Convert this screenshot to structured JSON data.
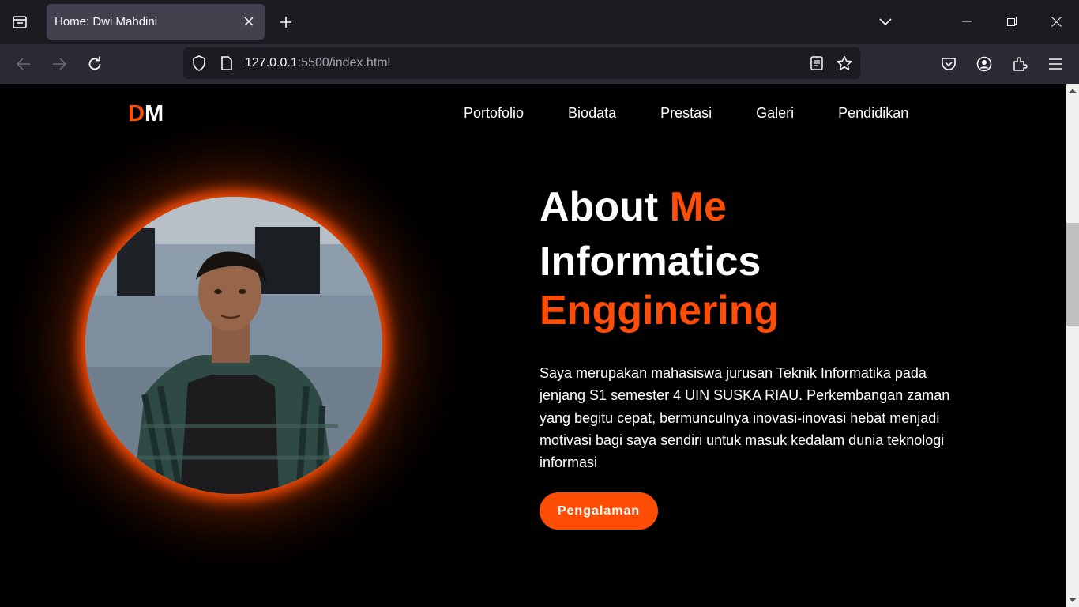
{
  "browser": {
    "tab": {
      "title": "Home: Dwi Mahdini"
    },
    "url": {
      "host": "127.0.0.1",
      "rest": ":5500/index.html"
    },
    "icons": [
      "tab-list-icon",
      "close-icon",
      "plus-icon",
      "chevron-down-icon",
      "minimize-icon",
      "restore-icon",
      "window-close-icon",
      "back-arrow-icon",
      "forward-arrow-icon",
      "reload-icon",
      "shield-icon",
      "page-icon",
      "reader-view-icon",
      "star-icon",
      "pocket-icon",
      "account-icon",
      "extensions-icon",
      "menu-icon"
    ]
  },
  "page": {
    "logo": {
      "first": "D",
      "second": "M"
    },
    "nav": [
      "Portofolio",
      "Biodata",
      "Prestasi",
      "Galeri",
      "Pendidikan"
    ],
    "hero": {
      "about_prefix": "About",
      "about_accent": "Me",
      "role_line1": "Informatics",
      "role_line2": "Engginering",
      "description": "Saya merupakan mahasiswa jurusan Teknik Informatika pada jenjang S1 semester 4 UIN SUSKA RIAU. Perkembangan zaman yang begitu cepat, bermunculnya inovasi-inovasi hebat menjadi motivasi bagi saya sendiri untuk masuk kedalam dunia teknologi informasi",
      "cta_label": "Pengalaman"
    },
    "colors": {
      "accent": "#ff4d05",
      "background": "#000000"
    }
  }
}
